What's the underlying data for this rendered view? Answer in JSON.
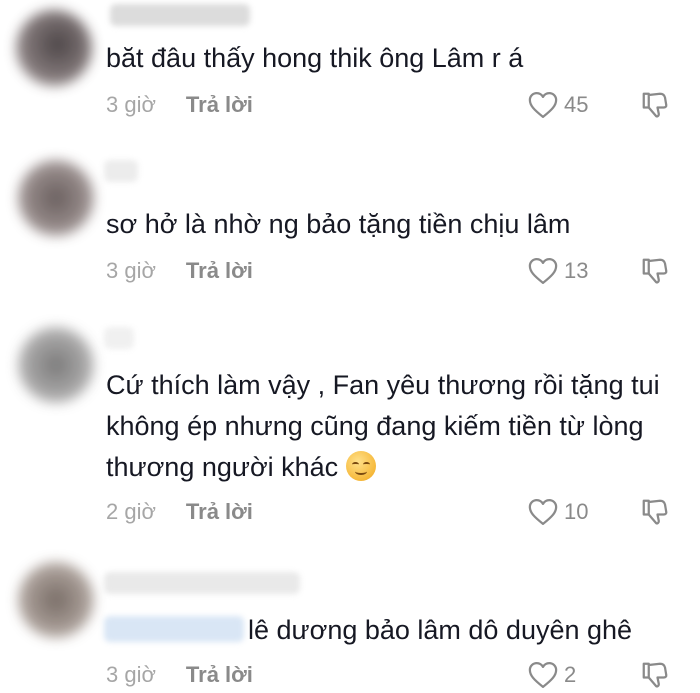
{
  "comments": [
    {
      "text": "băt đâu thấy hong thik ông Lâm r á",
      "time": "3 giờ",
      "reply": "Trả lời",
      "likes": "45"
    },
    {
      "text": "sơ hở là nhờ ng bảo tặng tiền chịu lâm",
      "time": "3 giờ",
      "reply": "Trả lời",
      "likes": "13"
    },
    {
      "text": "Cứ thích làm vậy , Fan yêu thương rồi tặng tui không ép nhưng cũng đang kiếm tiền từ lòng thương người khác",
      "time": "2 giờ",
      "reply": "Trả lời",
      "likes": "10"
    },
    {
      "text": "lê dương bảo lâm dô duyên ghê",
      "time": "3 giờ",
      "reply": "Trả lời",
      "likes": "2"
    }
  ],
  "icons": {
    "like": "heart-outline-icon",
    "dislike": "thumbs-down-outline-icon",
    "emoji": "smiling-face-emoji"
  },
  "colors": {
    "text": "#161823",
    "meta": "#a6a6a6",
    "icon": "#8a8a8a"
  }
}
